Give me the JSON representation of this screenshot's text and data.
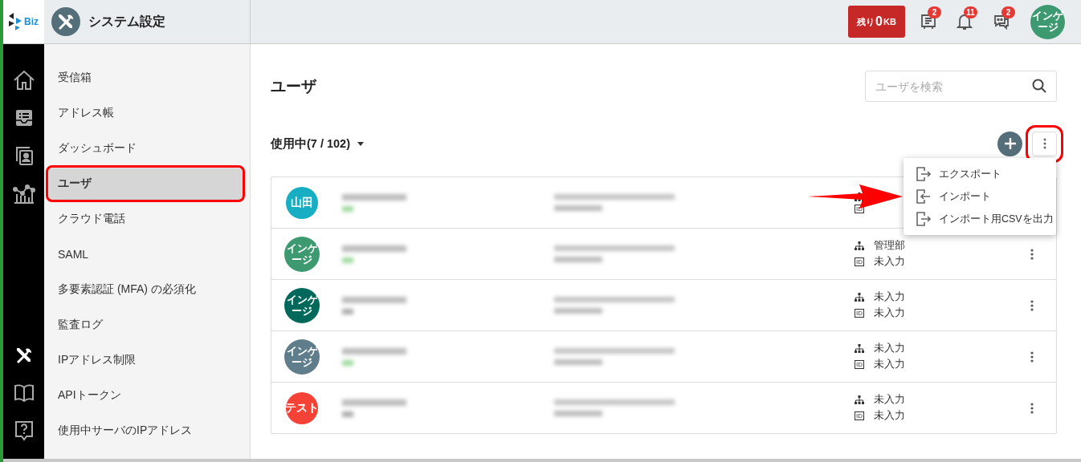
{
  "logo": {
    "text": "Biz"
  },
  "header": {
    "title": "システム設定",
    "storage": {
      "label": "残り",
      "value": "0",
      "unit": "KB"
    },
    "notifications": [
      {
        "kind": "tray",
        "count": "2"
      },
      {
        "kind": "bell",
        "count": "11"
      },
      {
        "kind": "chat",
        "count": "2"
      }
    ],
    "avatar": {
      "label": "インゲージ",
      "color": "#3d9970"
    }
  },
  "rail_top": [
    {
      "kind": "home",
      "selected": false
    },
    {
      "kind": "inbox",
      "selected": false
    },
    {
      "kind": "contacts",
      "selected": false
    },
    {
      "kind": "chart",
      "selected": false
    }
  ],
  "rail_bottom": [
    {
      "kind": "tools",
      "selected": true
    },
    {
      "kind": "book",
      "selected": false
    },
    {
      "kind": "help",
      "selected": false
    }
  ],
  "menu": [
    {
      "label": "受信箱",
      "selected": false,
      "annotated": false
    },
    {
      "label": "アドレス帳",
      "selected": false,
      "annotated": false
    },
    {
      "label": "ダッシュボード",
      "selected": false,
      "annotated": false
    },
    {
      "label": "ユーザ",
      "selected": true,
      "annotated": true
    },
    {
      "label": "クラウド電話",
      "selected": false,
      "annotated": false
    },
    {
      "label": "SAML",
      "selected": false,
      "annotated": false
    },
    {
      "label": "多要素認証 (MFA) の必須化",
      "selected": false,
      "annotated": false
    },
    {
      "label": "監査ログ",
      "selected": false,
      "annotated": false
    },
    {
      "label": "IPアドレス制限",
      "selected": false,
      "annotated": false
    },
    {
      "label": "APIトークン",
      "selected": false,
      "annotated": false
    },
    {
      "label": "使用中サーバのIPアドレス",
      "selected": false,
      "annotated": false
    }
  ],
  "page": {
    "title": "ユーザ",
    "search": {
      "placeholder": "ユーザを検索"
    },
    "filter": "使用中(7 / 102)",
    "more_annotated": true
  },
  "actions_menu": {
    "expanded": true,
    "items": [
      {
        "kind": "export",
        "label": "エクスポート",
        "pointed": false
      },
      {
        "kind": "import",
        "label": "インポート",
        "pointed": true
      },
      {
        "kind": "export",
        "label": "インポート用CSVを出力",
        "pointed": false
      }
    ]
  },
  "users": [
    {
      "avatar": "山田",
      "color": "#17aec4",
      "redacted": true,
      "status": true,
      "id_badge": "ID"
    },
    {
      "avatar": "インゲージ",
      "color": "#3d9970",
      "redacted": true,
      "status": true,
      "department": "管理部",
      "id_badge": "ID",
      "id": "未入力"
    },
    {
      "avatar": "インゲージ",
      "color": "#00695c",
      "redacted": true,
      "status": false,
      "department": "未入力",
      "id_badge": "ID",
      "id": "未入力"
    },
    {
      "avatar": "インゲージ",
      "color": "#607d8b",
      "redacted": true,
      "status": true,
      "department": "未入力",
      "id_badge": "ID",
      "id": "未入力"
    },
    {
      "avatar": "テスト",
      "color": "#f44336",
      "redacted": true,
      "status": false,
      "department": "未入力",
      "id_badge": "ID",
      "id": "未入力"
    }
  ]
}
